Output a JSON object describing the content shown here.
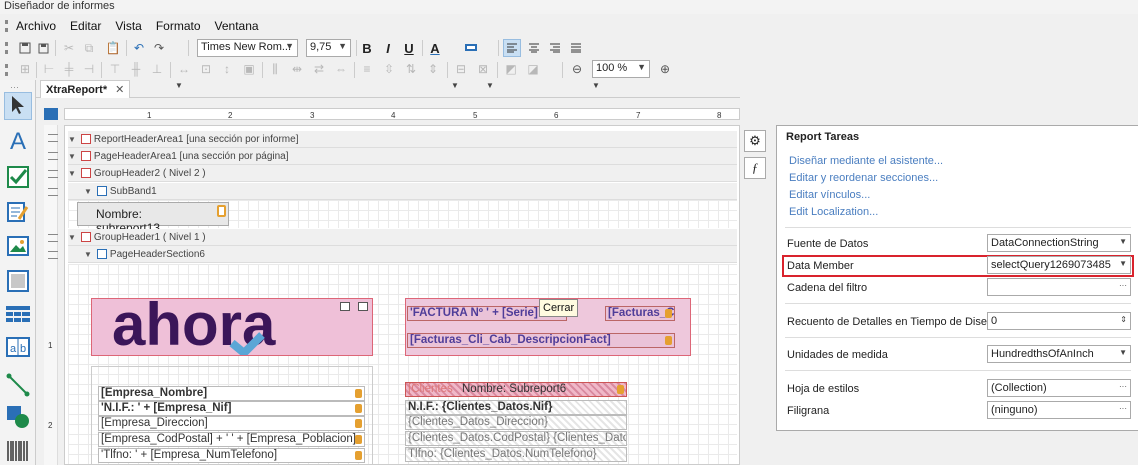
{
  "window": {
    "title": "Diseñador de informes"
  },
  "menu": [
    "Archivo",
    "Editar",
    "Vista",
    "Formato",
    "Ventana"
  ],
  "toolbar": {
    "font_name": "Times New Rom...",
    "font_size": "9,75",
    "zoom": "100 %"
  },
  "document_tab": {
    "label": "XtraReport*"
  },
  "ruler": {
    "ticks": [
      "1",
      "2",
      "3",
      "4",
      "5",
      "6",
      "7",
      "8"
    ],
    "left": [
      "1",
      "2"
    ]
  },
  "bands": {
    "report_header": "ReportHeaderArea1 [una sección por informe]",
    "page_header": "PageHeaderArea1 [una sección por página]",
    "group_header2": "GroupHeader2 ( Nivel 2 )",
    "sub_band": "SubBand1",
    "group_header1": "GroupHeader1 ( Nivel 1 )",
    "page_header_section": "PageHeaderSection6"
  },
  "subreport": "Nombre: subreport13...",
  "logo_text": "ahora",
  "fields": {
    "factura": "'FACTURA Nº ' + [Serie] + ...",
    "facturas_c": "[Facturas_C",
    "descripcion": "[Facturas_Cli_Cab_DescripcionFact]",
    "empresa_nombre": "[Empresa_Nombre]",
    "nif": "'N.I.F.: ' + [Empresa_Nif]",
    "empresa_direccion": "[Empresa_Direccion]",
    "codpostal": "[Empresa_CodPostal] + ' ' + [Empresa_Poblacion]",
    "tlfno": "'Tlfno: ' + [Empresa_NumTelefono]",
    "subreport6": "Nombre: Subreport6",
    "clientes_label": "[Clientes",
    "clientes_nif": "N.I.F.: {Clientes_Datos.Nif}",
    "clientes_direccion": "{Clientes_Datos_Direccion}",
    "clientes_codpostal": "{Clientes_Datos.CodPostal} {Clientes_Dato",
    "clientes_tlfno": "Tlfno: {Clientes_Datos.NumTelefono}"
  },
  "tooltip": "Cerrar",
  "tasks_panel": {
    "title": "Report Tareas",
    "links": [
      "Diseñar mediante el asistente...",
      "Editar y reordenar secciones...",
      "Editar vínculos...",
      "Edit Localization..."
    ],
    "properties": [
      {
        "label": "Fuente de Datos",
        "value": "DataConnectionString",
        "ctrl": "dropdown"
      },
      {
        "label": "Data Member",
        "value": "selectQuery1269073485",
        "ctrl": "dropdown",
        "highlight": true
      },
      {
        "label": "Cadena del filtro",
        "value": "",
        "ctrl": "ellipsis"
      },
      {
        "label": "Recuento de Detalles en Tiempo de Diseño",
        "value": "0",
        "ctrl": "spin"
      },
      {
        "label": "Unidades de medida",
        "value": "HundredthsOfAnInch",
        "ctrl": "dropdown"
      },
      {
        "label": "Hoja de estilos",
        "value": "(Collection)",
        "ctrl": "ellipsis"
      },
      {
        "label": "Filigrana",
        "value": "(ninguno)",
        "ctrl": "ellipsis"
      }
    ]
  },
  "colors": {
    "highlight": "#d9232d",
    "link": "#4a7ec0",
    "logo_purple": "#3b1659",
    "logo_blue": "#5aa6d6",
    "field_purple": "#4f3d99"
  }
}
